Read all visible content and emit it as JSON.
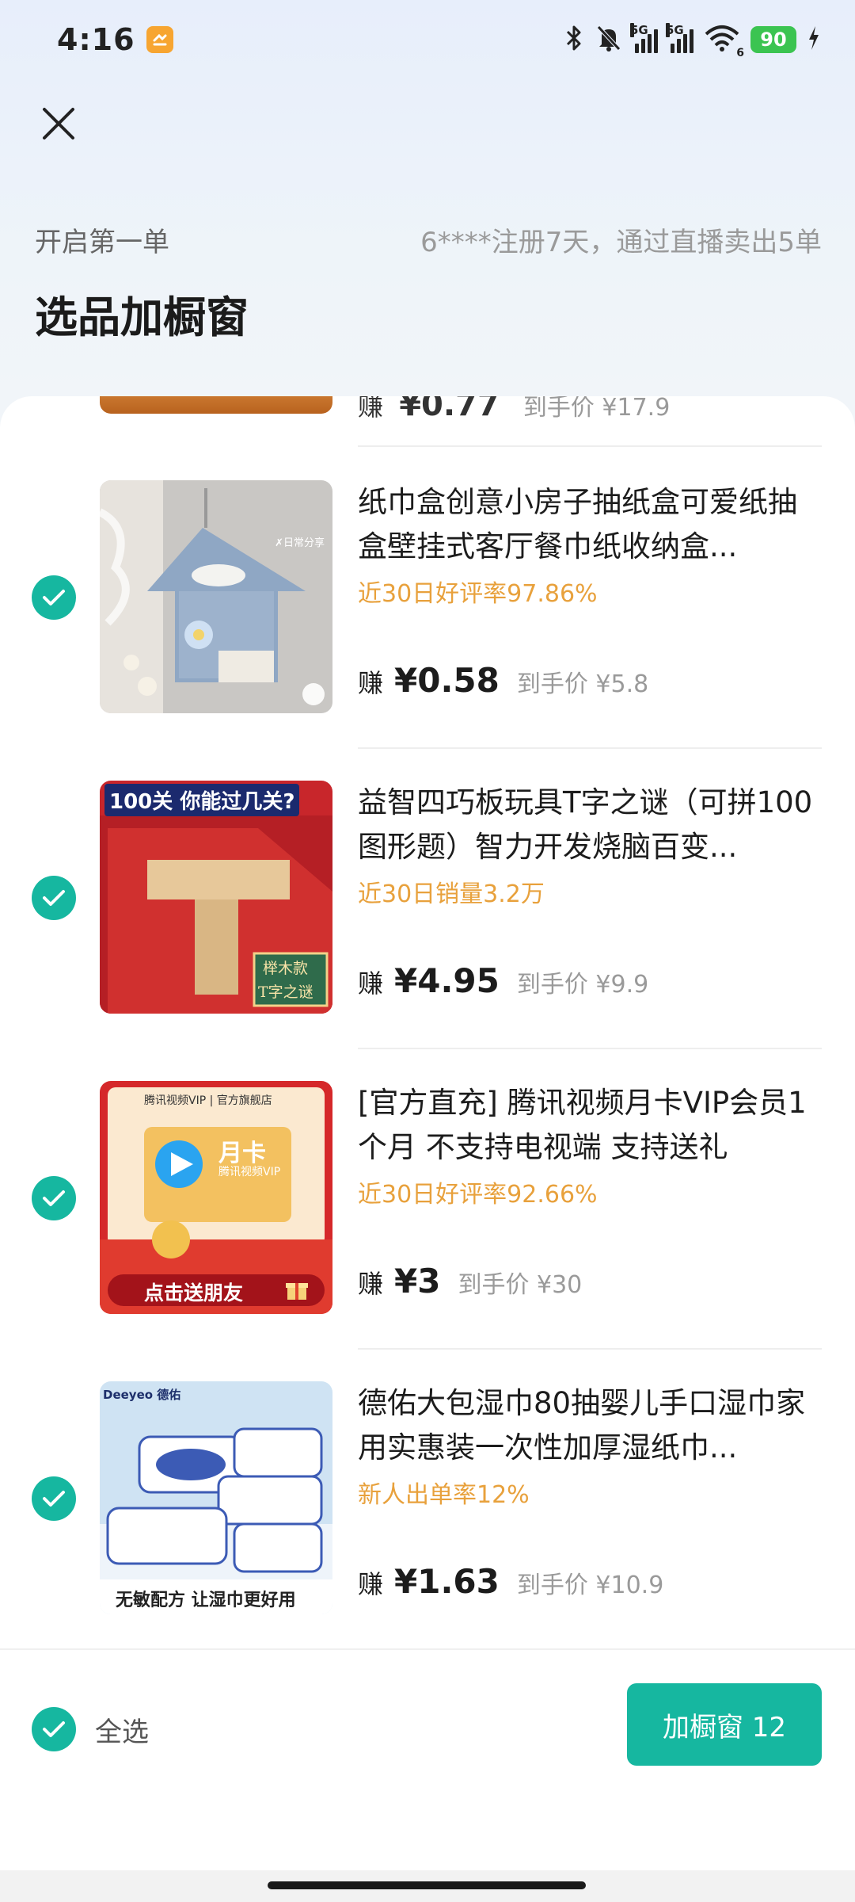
{
  "status_bar": {
    "time": "4:16",
    "signal1_label": "5G",
    "signal2_label": "5G",
    "wifi_label": "6",
    "battery": "90"
  },
  "header": {
    "subtitle": "开启第一单",
    "notice": "6****注册7天，通过直播卖出5单",
    "title": "选品加橱窗"
  },
  "partial_item": {
    "earn_label": "赚",
    "earn_amount": "¥0.77",
    "net_label": "到手价 ¥17.9"
  },
  "items": [
    {
      "title": "纸巾盒创意小房子抽纸盒可爱纸抽盒壁挂式客厅餐巾纸收纳盒...",
      "tag": "近30日好评率97.86%",
      "earn_label": "赚",
      "earn_amount": "¥0.58",
      "net_label": "到手价 ¥5.8",
      "thumb_caption": "✗日常分享"
    },
    {
      "title": "益智四巧板玩具T字之谜（可拼100图形题）智力开发烧脑百变...",
      "tag": "近30日销量3.2万",
      "earn_label": "赚",
      "earn_amount": "¥4.95",
      "net_label": "到手价 ¥9.9",
      "thumb_banner": "100关 你能过几关?",
      "thumb_badge_1": "榉木款",
      "thumb_badge_2": "T字之谜"
    },
    {
      "title": "[官方直充] 腾讯视频月卡VIP会员1个月 不支持电视端 支持送礼",
      "tag": "近30日好评率92.66%",
      "earn_label": "赚",
      "earn_amount": "¥3",
      "net_label": "到手价 ¥30",
      "thumb_header": "腾讯视频VIP | 官方旗舰店",
      "thumb_card": "月卡",
      "thumb_card_sub": "腾讯视频VIP",
      "thumb_footer": "点击送朋友"
    },
    {
      "title": "德佑大包湿巾80抽婴儿手口湿巾家用实惠装一次性加厚湿纸巾...",
      "tag": "新人出单率12%",
      "earn_label": "赚",
      "earn_amount": "¥1.63",
      "net_label": "到手价 ¥10.9",
      "thumb_brand": "Deeyeo 德佑",
      "thumb_footer": "无敏配方 让湿巾更好用"
    }
  ],
  "bottom_bar": {
    "select_all": "全选",
    "add_button": "加橱窗 12"
  },
  "colors": {
    "accent": "#16b7a0",
    "tag_orange": "#e8a13c"
  }
}
